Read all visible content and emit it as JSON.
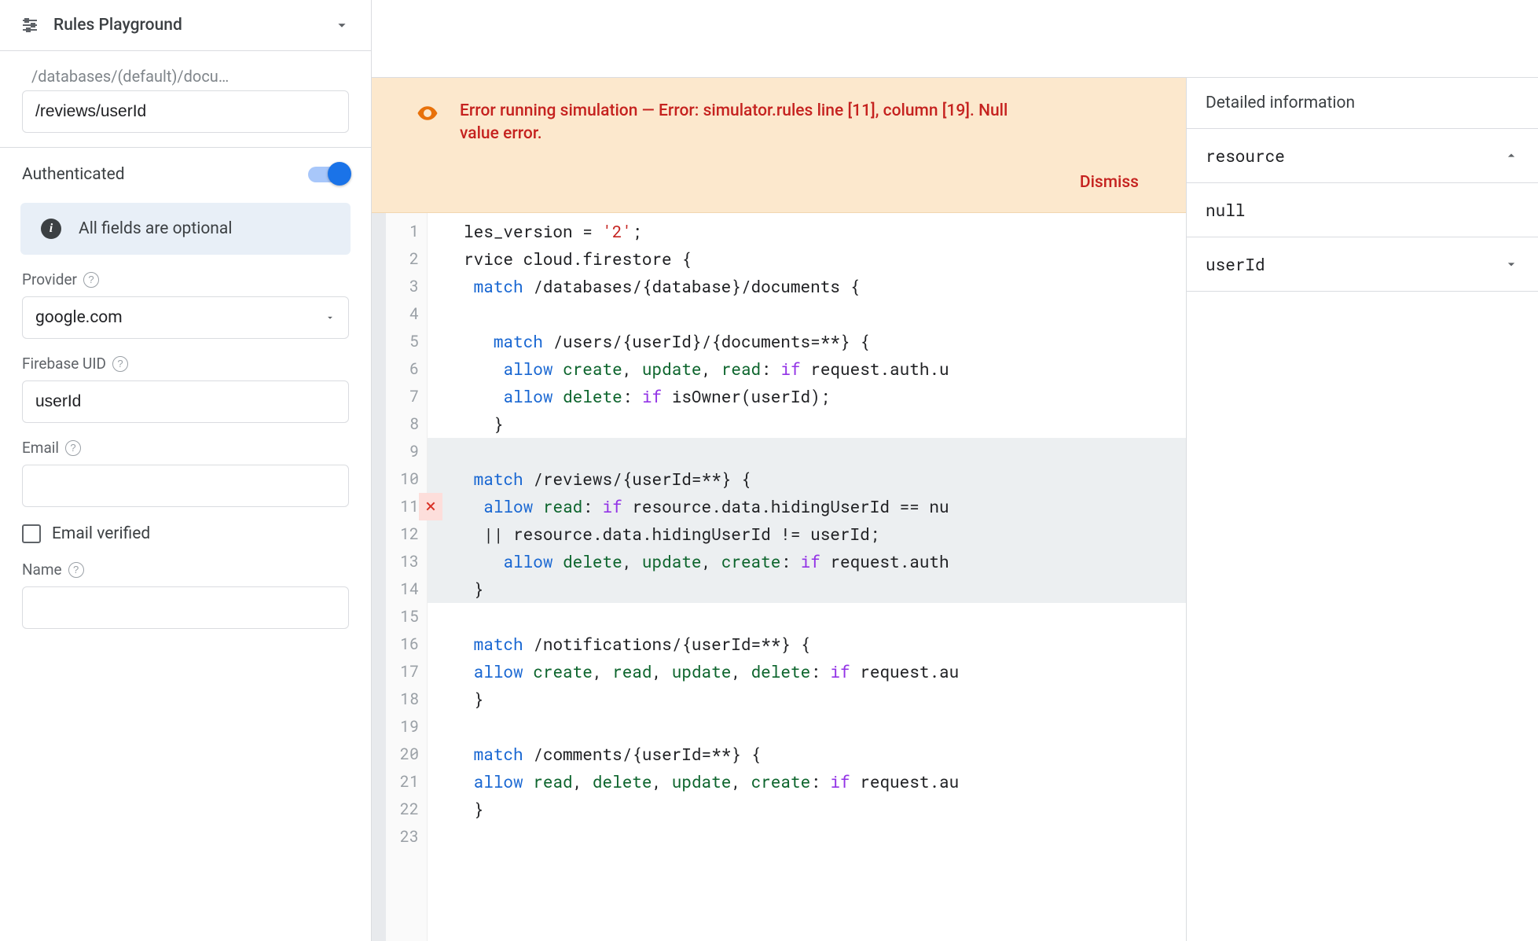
{
  "sidebar": {
    "title": "Rules Playground",
    "path_placeholder": "/databases/(default)/docu…",
    "path_value": "/reviews/userId",
    "authenticated_label": "Authenticated",
    "info_message": "All fields are optional",
    "provider_label": "Provider",
    "provider_value": "google.com",
    "uid_label": "Firebase UID",
    "uid_value": "userId",
    "email_label": "Email",
    "email_value": "",
    "email_verified_label": "Email verified",
    "name_label": "Name",
    "name_value": ""
  },
  "error": {
    "message": "Error running simulation — Error: simulator.rules line [11], column [19]. Null value error.",
    "dismiss": "Dismiss"
  },
  "editor": {
    "error_line": 11,
    "highlight_start": 9,
    "highlight_end": 14,
    "lines": [
      "les_version = '2';",
      "rvice cloud.firestore {",
      " match /databases/{database}/documents {",
      "",
      "   match /users/{userId}/{documents=**} {",
      "    allow create, update, read: if request.auth.u",
      "    allow delete: if isOwner(userId);",
      "   }",
      "",
      " match /reviews/{userId=**} {",
      "  allow read: if resource.data.hidingUserId == nu",
      "  || resource.data.hidingUserId != userId;",
      "    allow delete, update, create: if request.auth",
      " }",
      "",
      " match /notifications/{userId=**} {",
      " allow create, read, update, delete: if request.au",
      " }",
      "",
      " match /comments/{userId=**} {",
      " allow read, delete, update, create: if request.au",
      " }",
      ""
    ]
  },
  "details": {
    "title": "Detailed information",
    "rows": [
      {
        "key": "resource",
        "expanded": true,
        "value": "null"
      },
      {
        "key": "userId",
        "expanded": false
      }
    ]
  }
}
